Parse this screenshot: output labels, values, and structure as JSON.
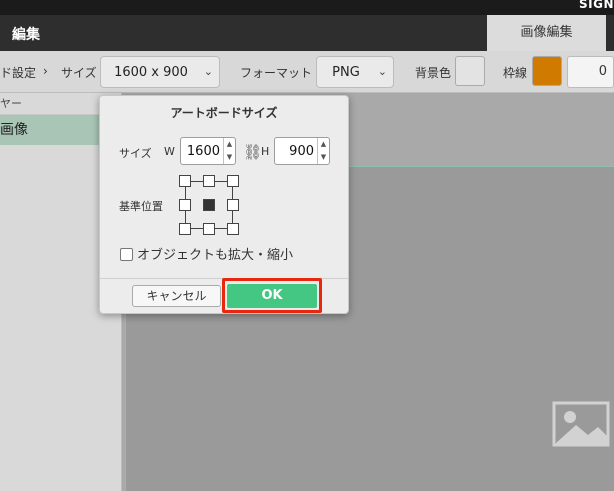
{
  "app": {
    "brand": "SIGN"
  },
  "menubar": {
    "edit_label": "編集",
    "image_edit_tab": "画像編集"
  },
  "toolbar": {
    "artboard_settings": "ド設定",
    "breadcrumb_sep": "›",
    "size_label": "サイズ",
    "size_value": "1600 x 900",
    "format_label": "フォーマット",
    "format_value": "PNG",
    "bg_color_label": "背景色",
    "border_label": "枠線",
    "border_width": "0",
    "colors": {
      "background": "#e3e3e3",
      "border": "#d07a00"
    }
  },
  "layers": {
    "header": "ヤー",
    "items": [
      {
        "label": "画像"
      }
    ]
  },
  "dialog": {
    "title": "アートボードサイズ",
    "size_label": "サイズ",
    "width_label": "W",
    "width_value": "1600",
    "height_label": "H",
    "height_value": "900",
    "anchor_label": "基準位置",
    "anchor_selected": "center",
    "scale_checkbox_label": "オブジェクトも拡大・縮小",
    "scale_checked": false,
    "cancel_label": "キャンセル",
    "ok_label": "OK",
    "colors": {
      "ok": "#44c782",
      "highlight": "#e8270f"
    }
  }
}
